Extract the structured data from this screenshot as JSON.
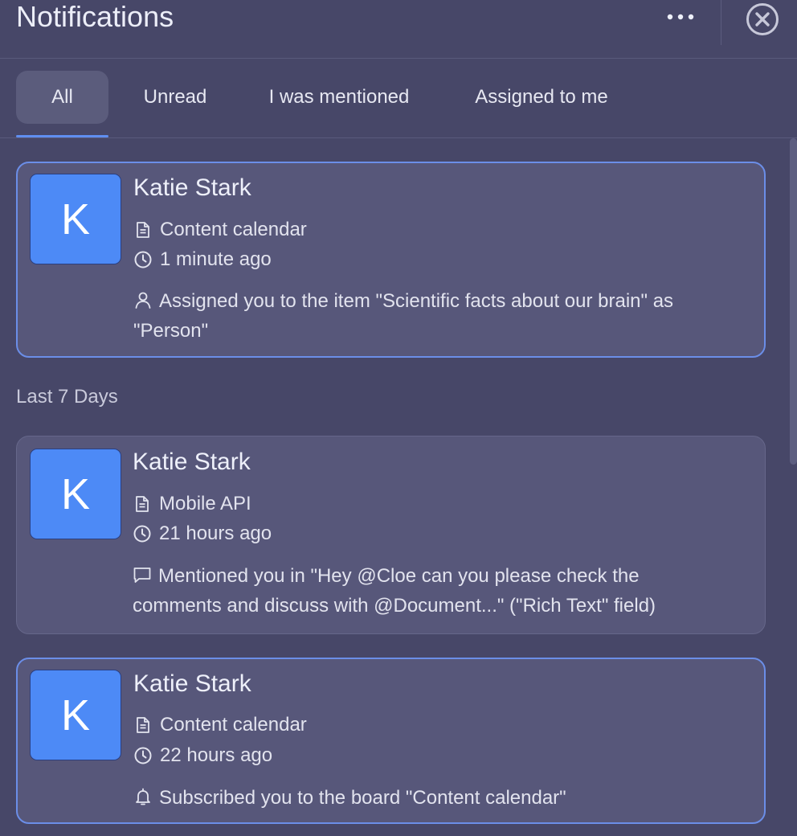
{
  "header": {
    "title": "Notifications",
    "more_icon": "more-horizontal-icon",
    "close_icon": "close-circle-icon"
  },
  "tabs": [
    {
      "label": "All",
      "active": true
    },
    {
      "label": "Unread",
      "active": false
    },
    {
      "label": "I was mentioned",
      "active": false
    },
    {
      "label": "Assigned to me",
      "active": false
    }
  ],
  "colors": {
    "background": "#474768",
    "card": "#57577a",
    "accent": "#5f8ef0",
    "avatar": "#4d8af6"
  },
  "sections": {
    "last7": "Last 7 Days"
  },
  "notifications": [
    {
      "avatar": "K",
      "sender": "Katie Stark",
      "board": "Content calendar",
      "time": "1 minute ago",
      "message_icon": "person-icon",
      "message": "Assigned you to the item \"Scientific facts about our brain\" as \"Person\"",
      "unread": true
    },
    {
      "avatar": "K",
      "sender": "Katie Stark",
      "board": "Mobile API",
      "time": "21 hours ago",
      "message_icon": "comment-icon",
      "message": "Mentioned you in \"Hey @Cloe can you please check the comments and discuss with @Document...\" (\"Rich Text\" field)",
      "unread": false
    },
    {
      "avatar": "K",
      "sender": "Katie Stark",
      "board": "Content calendar",
      "time": "22 hours ago",
      "message_icon": "bell-icon",
      "message": "Subscribed you to the board \"Content calendar\"",
      "unread": true
    }
  ]
}
